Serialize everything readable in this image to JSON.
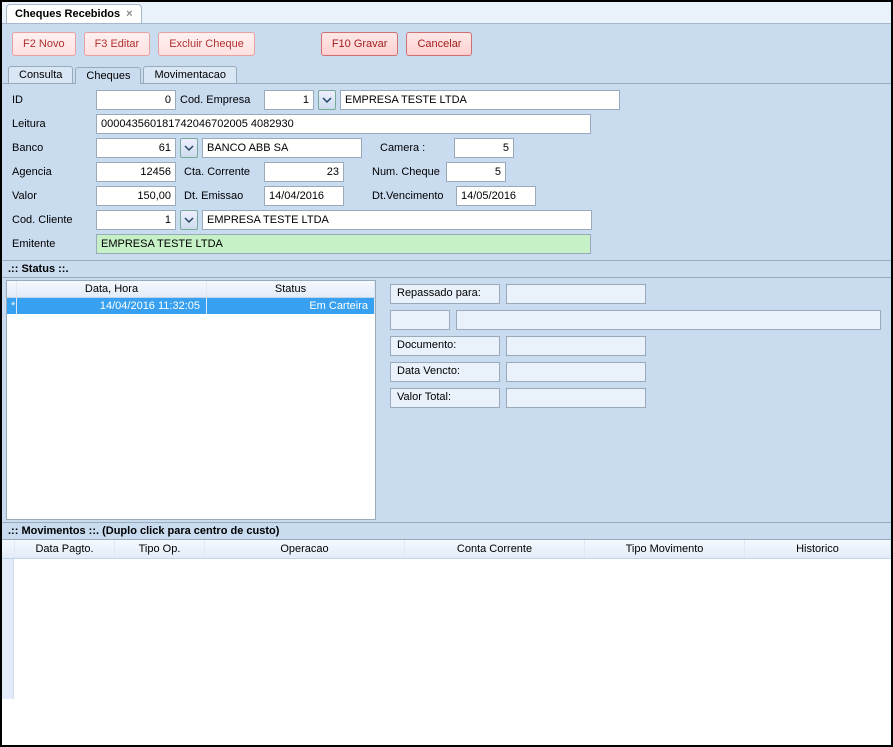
{
  "window": {
    "title": "Cheques Recebidos"
  },
  "toolbar": {
    "new": "F2 Novo",
    "edit": "F3 Editar",
    "delete": "Excluir Cheque",
    "save": "F10 Gravar",
    "cancel": "Cancelar"
  },
  "tabs": {
    "consulta": "Consulta",
    "cheques": "Cheques",
    "movimentacao": "Movimentacao"
  },
  "form": {
    "id_label": "ID",
    "id_value": "0",
    "cod_empresa_label": "Cod. Empresa",
    "cod_empresa_value": "1",
    "empresa_nome": "EMPRESA TESTE LTDA",
    "leitura_label": "Leitura",
    "leitura_value": "000043560181742046702005 4082930",
    "banco_label": "Banco",
    "banco_value": "61",
    "banco_nome": "BANCO ABB SA",
    "camera_label": "Camera :",
    "camera_value": "5",
    "agencia_label": "Agencia",
    "agencia_value": "12456",
    "cta_corrente_label": "Cta. Corrente",
    "cta_corrente_value": "23",
    "num_cheque_label": "Num. Cheque",
    "num_cheque_value": "5",
    "valor_label": "Valor",
    "valor_value": "150,00",
    "dt_emissao_label": "Dt. Emissao",
    "dt_emissao_value": "14/04/2016",
    "dt_vencimento_label": "Dt.Vencimento",
    "dt_vencimento_value": "14/05/2016",
    "cod_cliente_label": "Cod. Cliente",
    "cod_cliente_value": "1",
    "cliente_nome": "EMPRESA TESTE LTDA",
    "emitente_label": "Emitente",
    "emitente_value": "EMPRESA TESTE LTDA"
  },
  "status": {
    "header": ".:: Status ::.",
    "columns": {
      "data_hora": "Data, Hora",
      "status": "Status"
    },
    "row_marker": "*",
    "rows": [
      {
        "data_hora": "14/04/2016 11:32:05",
        "status": "Em Carteira"
      }
    ],
    "side": {
      "repassado_label": "Repassado para:",
      "repassado_value": "",
      "repassado_extra1": "",
      "repassado_extra2": "",
      "documento_label": "Documento:",
      "documento_value": "",
      "data_vencto_label": "Data Vencto:",
      "data_vencto_value": "",
      "valor_total_label": "Valor Total:",
      "valor_total_value": ""
    }
  },
  "movimentos": {
    "header": ".:: Movimentos ::.  (Duplo click para centro de custo)",
    "columns": {
      "data_pagto": "Data Pagto.",
      "tipo_op": "Tipo Op.",
      "operacao": "Operacao",
      "conta_corrente": "Conta Corrente",
      "tipo_movimento": "Tipo Movimento",
      "historico": "Historico"
    }
  }
}
